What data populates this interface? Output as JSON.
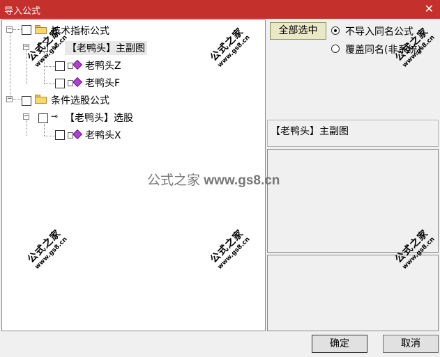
{
  "window": {
    "title": "导入公式"
  },
  "tree": {
    "nodes": [
      {
        "label": "技术指标公式"
      },
      {
        "label": "【老鸭头】主副图"
      },
      {
        "label": "老鸭头Z"
      },
      {
        "label": "老鸭头F"
      },
      {
        "label": "条件选股公式"
      },
      {
        "label": "【老鸭头】选股"
      },
      {
        "label": "老鸭头X"
      }
    ]
  },
  "options": {
    "select_all_label": "全部选中",
    "radio_skip_label": "不导入同名公式",
    "radio_overwrite_label": "覆盖同名(非系统)",
    "selected": "skip"
  },
  "info": {
    "selected_formula": "【老鸭头】主副图"
  },
  "buttons": {
    "ok_label": "确定",
    "cancel_label": "取消"
  },
  "watermark": {
    "cn": "公式之家",
    "url": "www.gs8.cn",
    "center_cn": "公式之家",
    "center_en": "www.gs8.cn"
  }
}
